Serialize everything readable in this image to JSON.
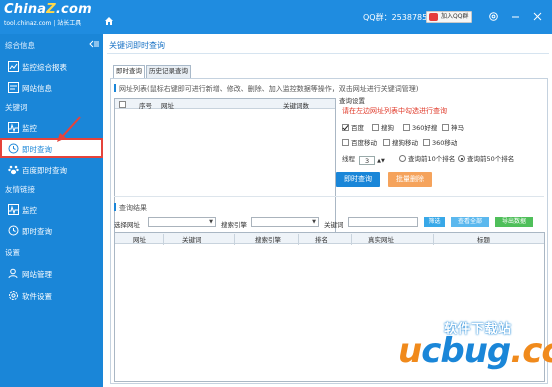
{
  "app": {
    "logo": "China",
    "logo_z": "Z",
    "logo_tld": ".com",
    "logo_sub": "tool.chinaz.com | 站长工具",
    "qq_group": "QQ群：253878567",
    "qq_join": "加入QQ群"
  },
  "sidebar": {
    "groups": {
      "overview": "综合信息",
      "keywords": "关键词",
      "links": "友情链接",
      "settings": "设置"
    },
    "items": {
      "monitor_report": "监控综合报表",
      "site_info": "网站信息",
      "kw_monitor": "监控",
      "kw_realtime": "即时查询",
      "baidu_realtime": "百度即时查询",
      "link_monitor": "监控",
      "link_realtime": "即时查询",
      "site_manage": "网站管理",
      "software_settings": "软件设置"
    }
  },
  "main": {
    "page_title": "关键词即时查询",
    "tabs": [
      "即时查询",
      "历史记录查询"
    ],
    "url_list_header": "网址列表(鼠标右键即可进行新增、修改、删除、加入监控数据等操作，双击网址进行关键词管理)",
    "url_table_columns": [
      "序号",
      "网址",
      "关键词数"
    ],
    "query_settings": {
      "title": "查询设置",
      "hint": "请在左边网址列表中勾选进行查询",
      "engines_row1": [
        {
          "label": "百度",
          "checked": true
        },
        {
          "label": "搜狗",
          "checked": false
        },
        {
          "label": "360好搜",
          "checked": false
        },
        {
          "label": "神马",
          "checked": false
        }
      ],
      "engines_row2": [
        {
          "label": "百度移动",
          "checked": false
        },
        {
          "label": "搜狗移动",
          "checked": false
        },
        {
          "label": "360移动",
          "checked": false
        }
      ],
      "thread_label": "线程",
      "thread_value": "3",
      "rank_options": [
        {
          "label": "查询前10个排名",
          "selected": false
        },
        {
          "label": "查询前50个排名",
          "selected": true
        }
      ]
    },
    "buttons": {
      "query": "即时查询",
      "batch_delete": "批量删除"
    },
    "results": {
      "header": "查询结果",
      "filter_url_label": "选择网址",
      "filter_engine_label": "搜索引擎",
      "filter_keyword_label": "关键词",
      "filter_button": "筛选",
      "view_all_button": "查看全部",
      "export_button": "导出数据",
      "columns": [
        "网址",
        "关键词",
        "搜索引擎",
        "排名",
        "真实网址",
        "标题"
      ]
    }
  },
  "watermark": {
    "top": "软件下载站",
    "u": "u",
    "c": "c",
    "bug": "bug",
    "dot": ".",
    "cc": "cc"
  },
  "colors": {
    "titlebar": "#1f8ce0",
    "sidebar": "#1a86d8",
    "accent_red": "#e5433b",
    "hint_red": "#e03a2a",
    "query_button": "#1a86d8",
    "batch_delete_button": "#f5a35c",
    "filter_button": "#38a8e8",
    "view_all_button": "#5bb8ee",
    "export_button": "#4fbf5a"
  }
}
